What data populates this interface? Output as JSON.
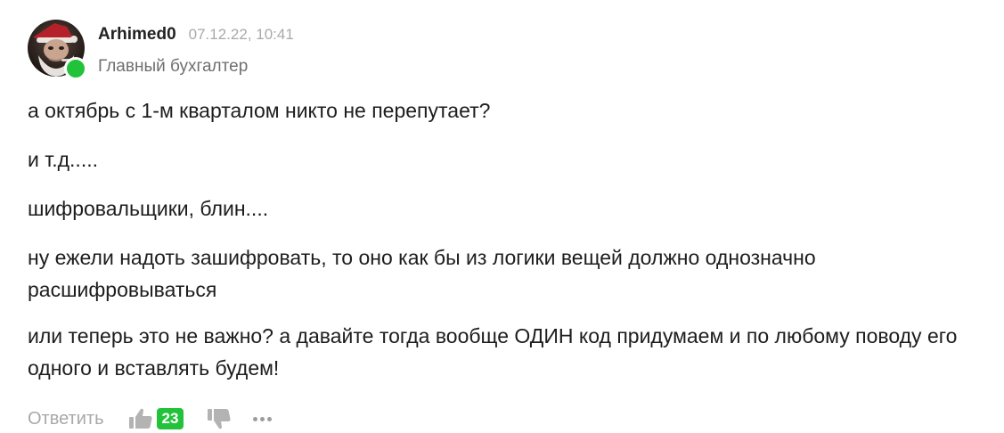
{
  "author": {
    "name": "Arhimed0",
    "role": "Главный бухгалтер",
    "online": true
  },
  "comment": {
    "date": "07.12.22, 10:41",
    "paragraphs": [
      "а октябрь с 1-м кварталом никто не перепутает?",
      "и т.д.....",
      "шифровальщики, блин....",
      "ну ежели надоть зашифровать, то оно как бы из логики вещей должно однозначно расшифровываться",
      "или теперь это не важно? а давайте тогда вообще ОДИН код придумаем и по любому поводу его одного и вставлять будем!"
    ]
  },
  "actions": {
    "reply_label": "Ответить",
    "like_count": "23",
    "like_icon": "thumbs-up-icon",
    "dislike_icon": "thumbs-down-icon",
    "more_icon": "more-dots-icon"
  },
  "colors": {
    "accent_green": "#22c33a",
    "muted_text": "#a8a8a8"
  }
}
